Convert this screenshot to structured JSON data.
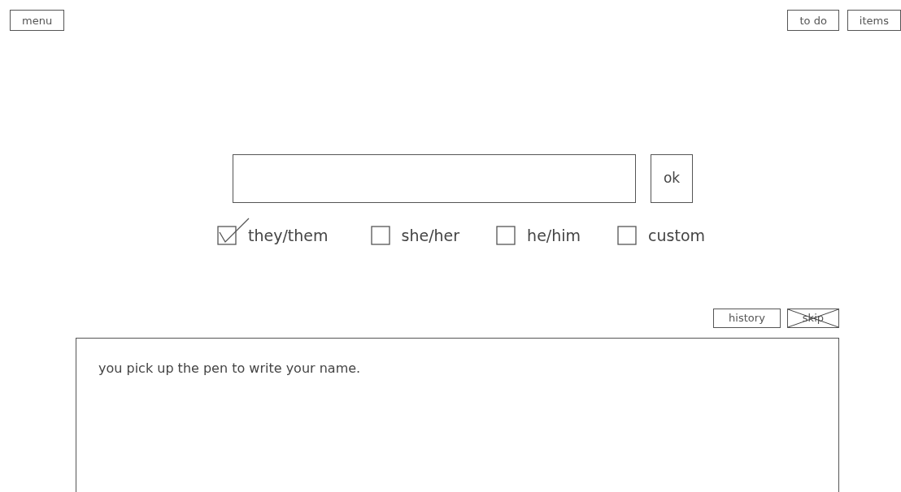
{
  "top_left_buttons": [
    "menu"
  ],
  "top_right_buttons": [
    "to do",
    "items"
  ],
  "ok_button": "ok",
  "pronouns": [
    {
      "label": "they/them",
      "checked": true
    },
    {
      "label": "she/her",
      "checked": false
    },
    {
      "label": "he/him",
      "checked": false
    },
    {
      "label": "custom",
      "checked": false
    }
  ],
  "panel_buttons": [
    {
      "label": "history",
      "disabled": false
    },
    {
      "label": "skip",
      "disabled": true
    }
  ],
  "story_text": "you pick up the pen to write your name."
}
